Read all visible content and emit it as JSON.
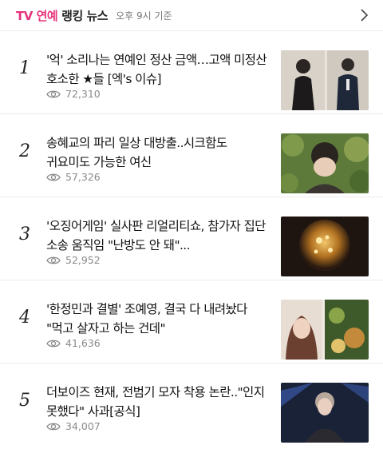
{
  "header": {
    "brand": "TV 연예",
    "title": "랭킹 뉴스",
    "time": "오후 9시 기준"
  },
  "items": [
    {
      "rank": "1",
      "headline": "'억' 소리나는 연예인 정산 금액…고액 미정산 호소한 ★들 [엑's 이슈]",
      "views": "72,310"
    },
    {
      "rank": "2",
      "headline": "송혜교의 파리 일상 대방출..시크함도 귀요미도 가능한 여신",
      "views": "57,326"
    },
    {
      "rank": "3",
      "headline": "'오징어게임' 실사판 리얼리티쇼, 참가자 집단 소송 움직임 \"난방도 안 돼\"...",
      "views": "52,952"
    },
    {
      "rank": "4",
      "headline": "'한정민과 결별' 조예영, 결국 다 내려놨다 \"먹고 살자고 하는 건데\"",
      "views": "41,636"
    },
    {
      "rank": "5",
      "headline": "더보이즈 현재, 전범기 모자 착용 논란..\"인지 못했다\" 사과[공식]",
      "views": "34,007"
    }
  ],
  "icons": {
    "views": "eye-icon",
    "more": "chevron-right-icon"
  },
  "colors": {
    "brand": "#e6337c",
    "meta": "#8a8a8a"
  }
}
